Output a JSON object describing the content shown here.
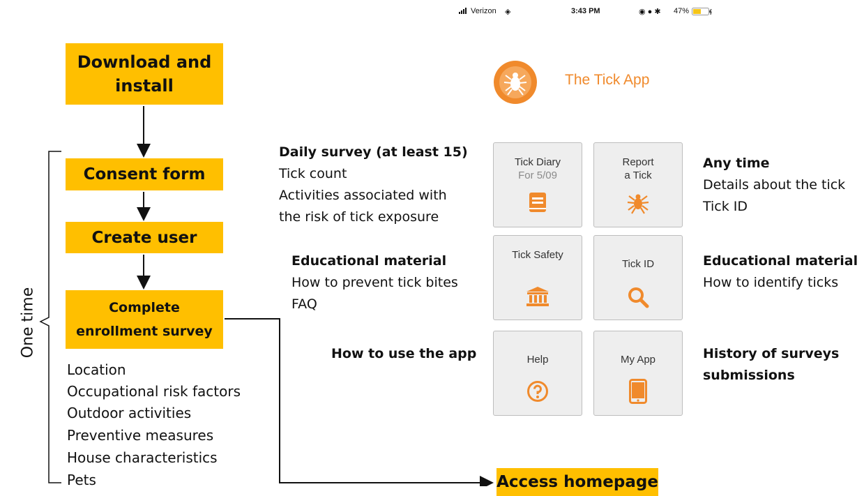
{
  "status_bar": {
    "carrier": "Verizon",
    "time": "3:43 PM",
    "battery": "47%"
  },
  "app": {
    "name": "The Tick App"
  },
  "flow": {
    "download": [
      "Download and",
      "install"
    ],
    "consent": "Consent form",
    "create_user": "Create user",
    "enrollment": [
      "Complete",
      "enrollment survey"
    ],
    "access": "Access homepage",
    "one_time": "One time"
  },
  "enrollment_items": [
    "Location",
    "Occupational risk factors",
    "Outdoor activities",
    "Preventive measures",
    "House characteristics",
    "Pets"
  ],
  "tiles": {
    "tick_diary": {
      "label": "Tick Diary",
      "sub": "For 5/09",
      "icon": "book-icon"
    },
    "report_tick": {
      "label_1": "Report",
      "label_2": "a Tick",
      "icon": "tick-icon"
    },
    "tick_safety": {
      "label": "Tick Safety",
      "icon": "bank-icon"
    },
    "tick_id": {
      "label": "Tick ID",
      "icon": "search-icon"
    },
    "help": {
      "label": "Help",
      "icon": "question-icon"
    },
    "my_app": {
      "label": "My App",
      "icon": "tablet-icon"
    }
  },
  "annotations": {
    "daily": {
      "title": "Daily survey (at least 15)",
      "lines": [
        "Tick count",
        "Activities associated with",
        "the risk of tick exposure"
      ]
    },
    "anytime": {
      "title": "Any time",
      "lines": [
        "Details about the tick",
        "Tick ID"
      ]
    },
    "edu_left": {
      "title": "Educational material",
      "lines": [
        "How to prevent tick bites",
        "FAQ"
      ]
    },
    "edu_right": {
      "title": "Educational material",
      "lines": [
        "How to identify ticks"
      ]
    },
    "how_to": {
      "title": "How to use the app"
    },
    "history": {
      "lines": [
        "History of surveys",
        "submissions"
      ]
    }
  },
  "colors": {
    "box": "#FFBF00",
    "app_orange": "#F08A2C"
  }
}
